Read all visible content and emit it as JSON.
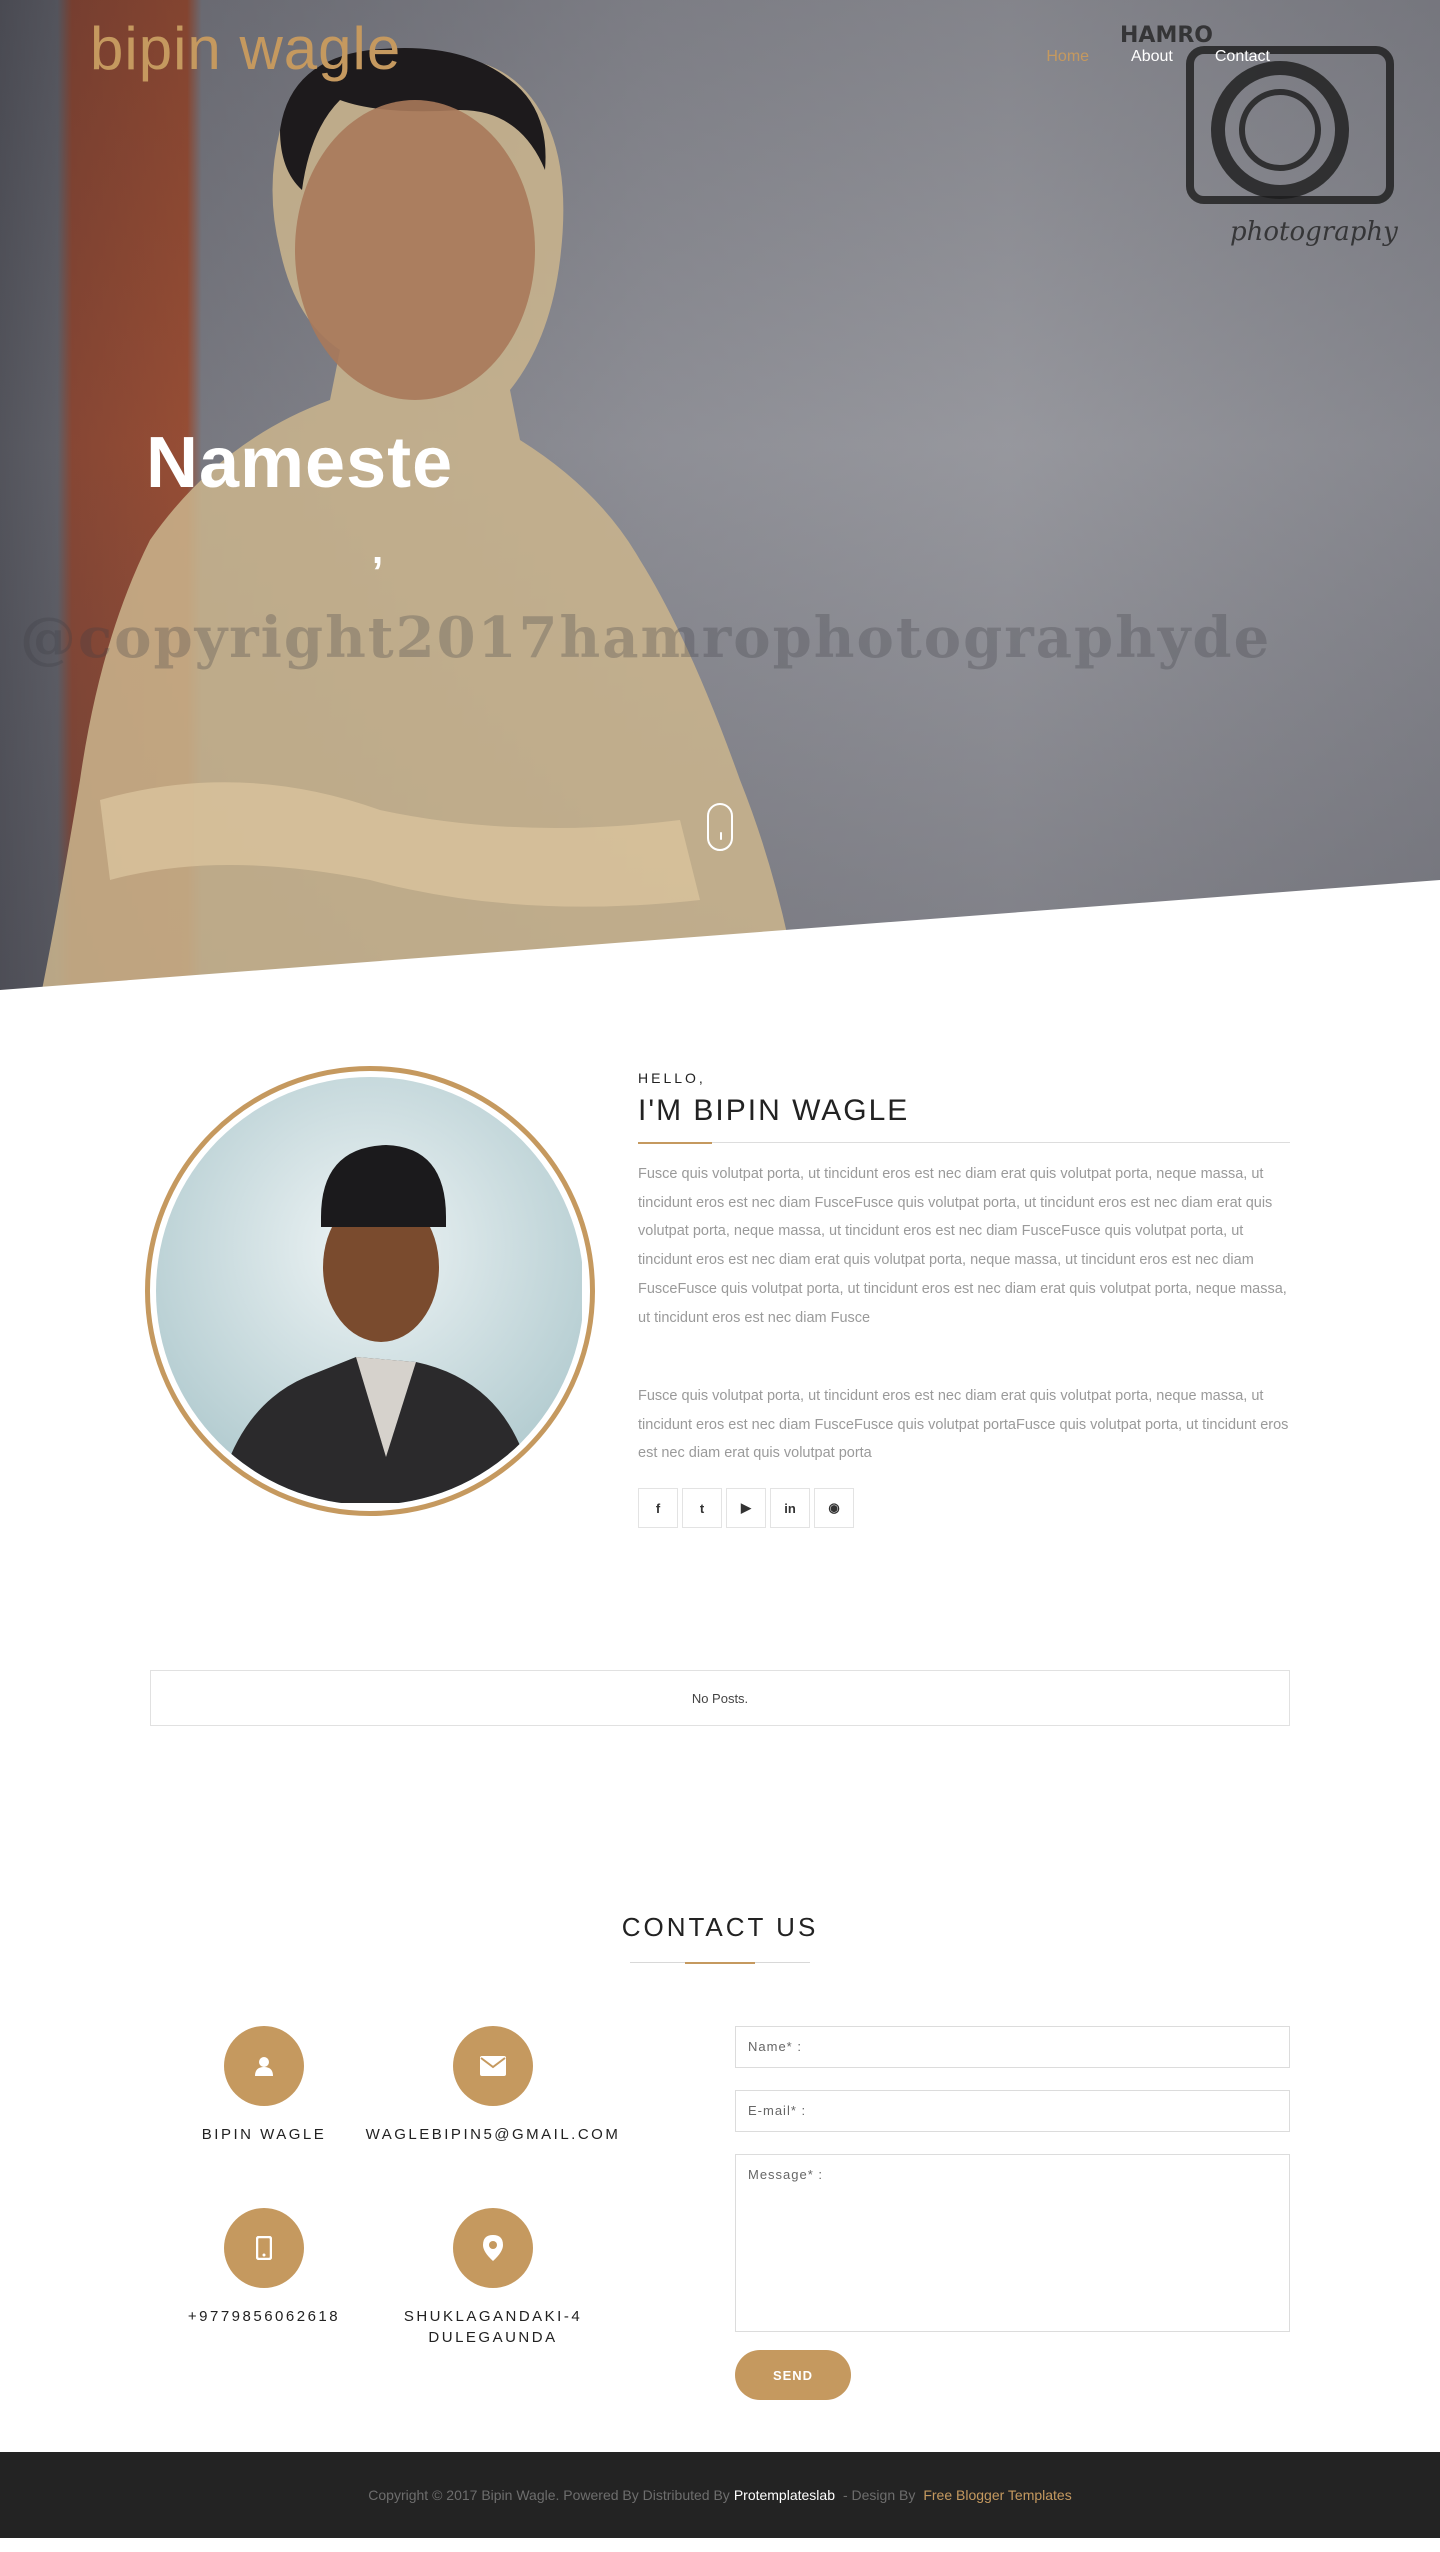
{
  "header": {
    "logo": "bipin wagle",
    "nav": [
      {
        "label": "Home",
        "active": true
      },
      {
        "label": "About",
        "active": false
      },
      {
        "label": "Contact",
        "active": false
      }
    ]
  },
  "hero": {
    "title": "Nameste",
    "subtitle": ",",
    "watermark": "@copyright2017hamrophotographyde",
    "photo_mark_top": "HAMRO",
    "photo_mark_bottom": "photography"
  },
  "about": {
    "greeting": "HELLO,",
    "name": "I'M BIPIN WAGLE",
    "paragraph1": "Fusce quis volutpat porta, ut tincidunt eros est nec diam erat quis volutpat porta, neque massa, ut tincidunt eros est nec diam FusceFusce quis volutpat porta, ut tincidunt eros est nec diam erat quis volutpat porta, neque massa, ut tincidunt eros est nec diam FusceFusce quis volutpat porta, ut tincidunt eros est nec diam erat quis volutpat porta, neque massa, ut tincidunt eros est nec diam FusceFusce quis volutpat porta, ut tincidunt eros est nec diam erat quis volutpat porta, neque massa, ut tincidunt eros est nec diam Fusce",
    "paragraph2": "Fusce quis volutpat porta, ut tincidunt eros est nec diam erat quis volutpat porta, neque massa, ut tincidunt eros est nec diam FusceFusce quis volutpat portaFusce quis volutpat porta, ut tincidunt eros est nec diam erat quis volutpat porta",
    "socials": [
      {
        "icon": "facebook-icon",
        "glyph": "f"
      },
      {
        "icon": "twitter-icon",
        "glyph": "t"
      },
      {
        "icon": "youtube-icon",
        "glyph": "▶"
      },
      {
        "icon": "linkedin-icon",
        "glyph": "in"
      },
      {
        "icon": "github-icon",
        "glyph": "◉"
      }
    ]
  },
  "posts": {
    "empty_text": "No Posts."
  },
  "contact": {
    "title": "CONTACT US",
    "name": "BIPIN WAGLE",
    "email": "WAGLEBIPIN5@GMAIL.COM",
    "phone": "+9779856062618",
    "address_line1": "SHUKLAGANDAKI-4",
    "address_line2": "DULEGAUNDA",
    "form": {
      "name_placeholder": "Name* :",
      "email_placeholder": "E-mail* :",
      "message_placeholder": "Message* :",
      "send_label": "SEND"
    }
  },
  "footer": {
    "prefix": "Copyright © 2017 Bipin Wagle. Powered By Distributed By",
    "distributor": "Protemplateslab",
    "middle": "- Design By",
    "designer": "Free Blogger Templates"
  },
  "colors": {
    "accent": "#c5995f",
    "footer_bg": "#232323",
    "body_text": "#9a9a9a"
  }
}
